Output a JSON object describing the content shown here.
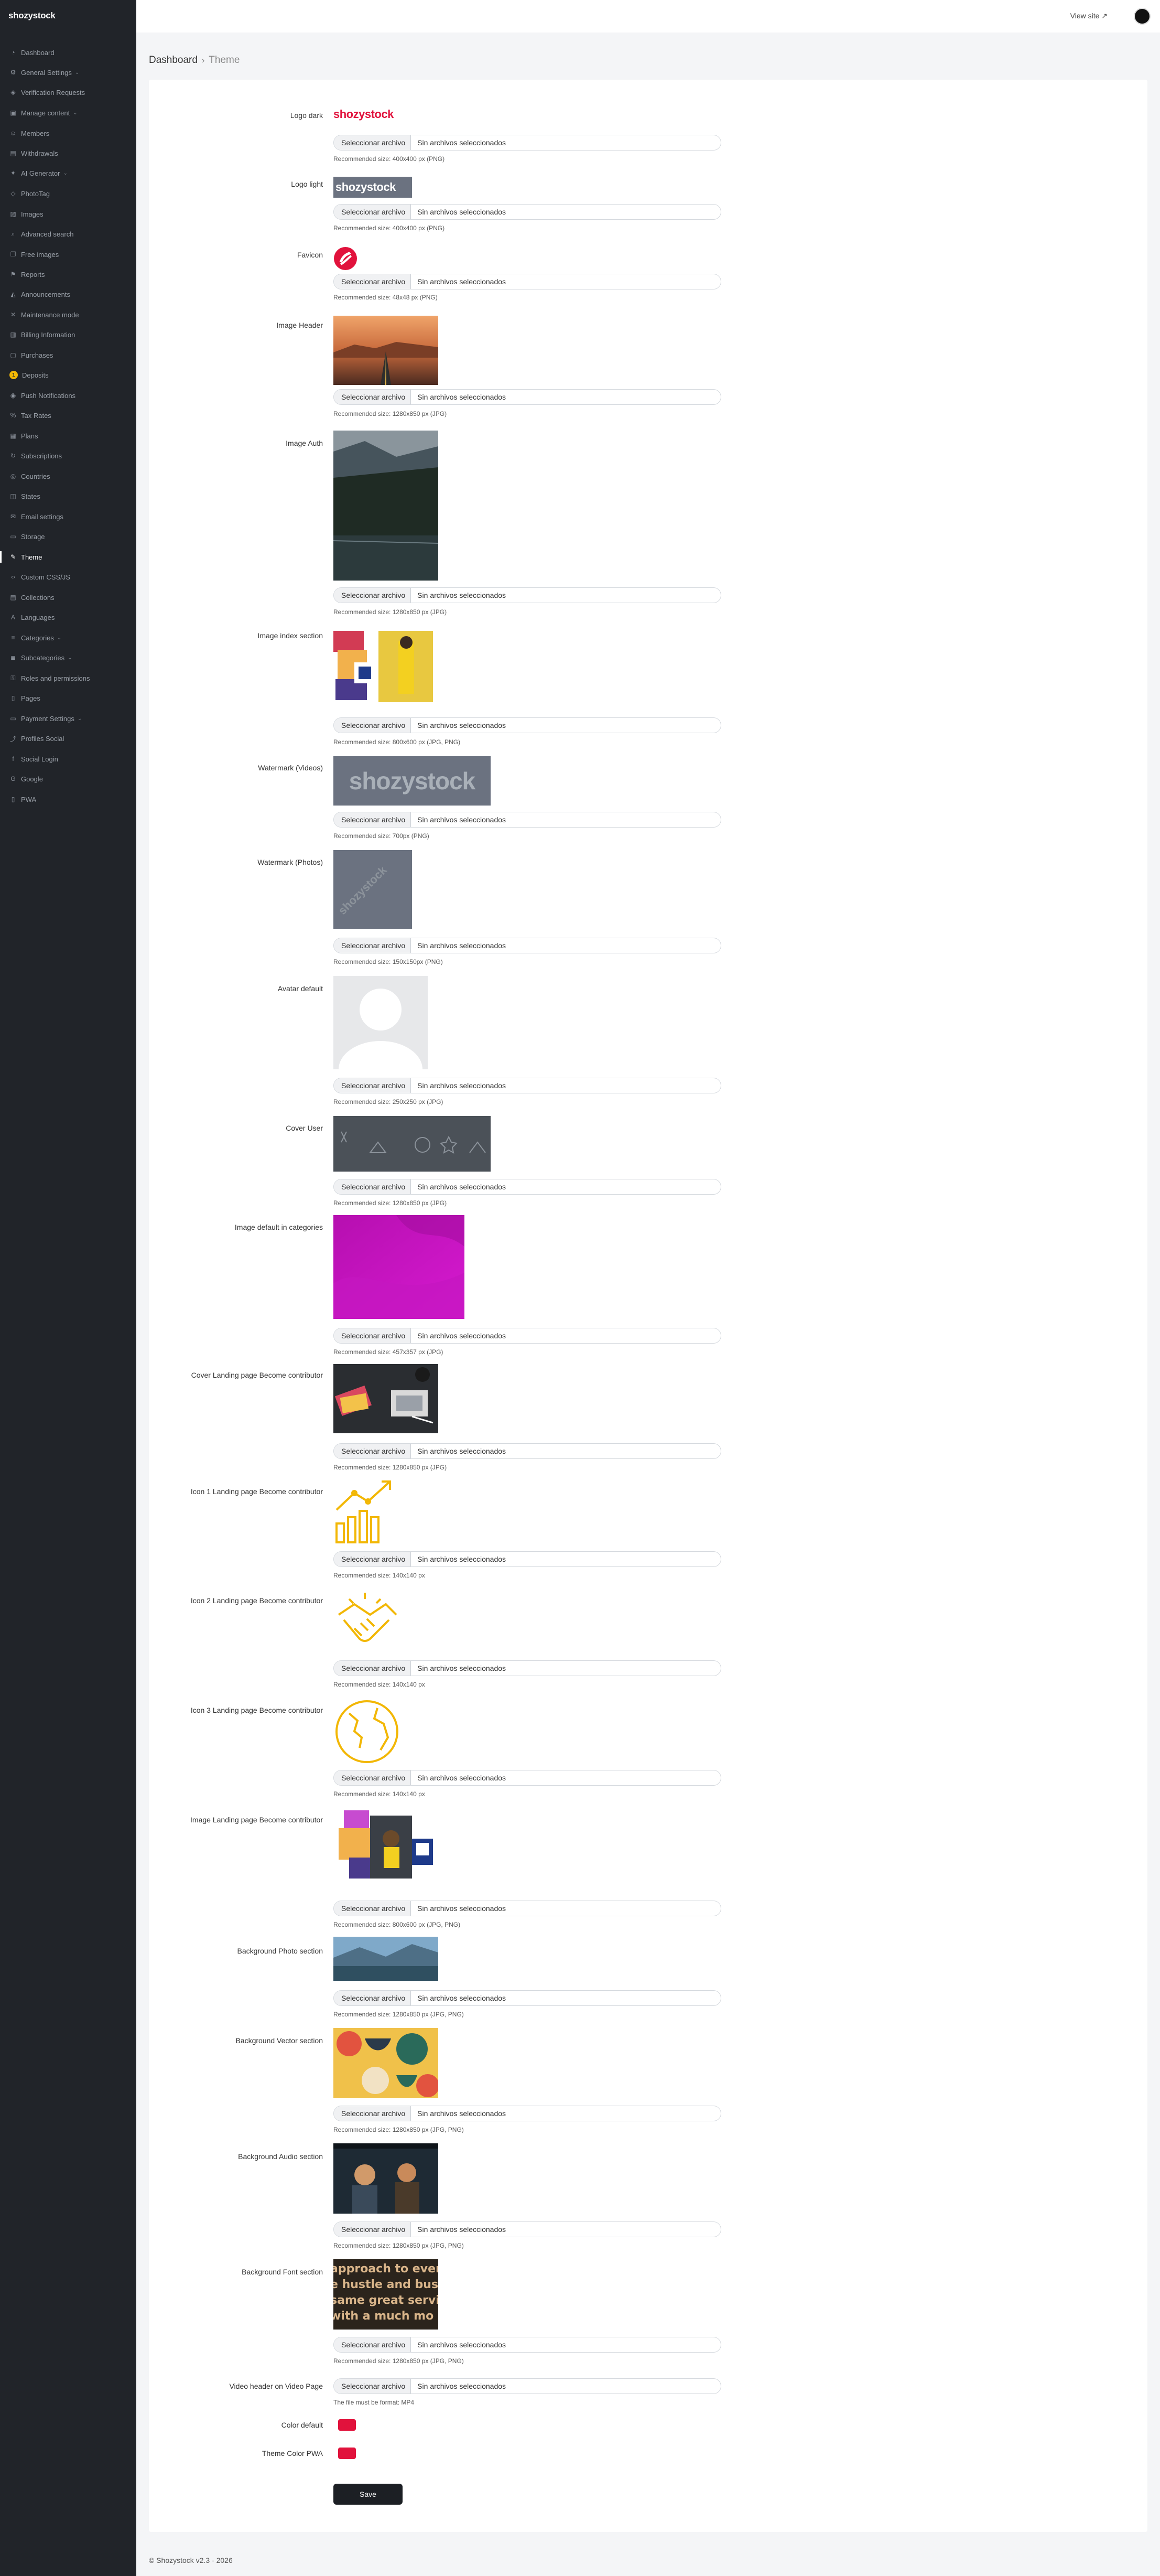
{
  "sidebar": {
    "brand": "shozystock",
    "items": [
      {
        "label": "Dashboard",
        "icon": "speedometer-icon",
        "glyph": "◔"
      },
      {
        "label": "General Settings",
        "icon": "gear-icon",
        "glyph": "⚙",
        "chevron": true
      },
      {
        "label": "Verification Requests",
        "icon": "shield-check-icon",
        "glyph": "◈"
      },
      {
        "label": "Manage content",
        "icon": "images-icon",
        "glyph": "▣",
        "chevron": true
      },
      {
        "label": "Members",
        "icon": "people-icon",
        "glyph": "☺"
      },
      {
        "label": "Withdrawals",
        "icon": "bank-icon",
        "glyph": "▤"
      },
      {
        "label": "AI Generator",
        "icon": "robot-icon",
        "glyph": "✦",
        "chevron": true
      },
      {
        "label": "PhotoTag",
        "icon": "tag-icon",
        "glyph": "◇"
      },
      {
        "label": "Images",
        "icon": "image-icon",
        "glyph": "▨"
      },
      {
        "label": "Advanced search",
        "icon": "search-icon",
        "glyph": "⌕"
      },
      {
        "label": "Free images",
        "icon": "gift-icon",
        "glyph": "❐"
      },
      {
        "label": "Reports",
        "icon": "flag-icon",
        "glyph": "⚑"
      },
      {
        "label": "Announcements",
        "icon": "megaphone-icon",
        "glyph": "◭"
      },
      {
        "label": "Maintenance mode",
        "icon": "tools-icon",
        "glyph": "✕"
      },
      {
        "label": "Billing Information",
        "icon": "receipt-icon",
        "glyph": "▥"
      },
      {
        "label": "Purchases",
        "icon": "bag-icon",
        "glyph": "▢"
      },
      {
        "label": "Deposits",
        "icon": "cash-icon",
        "glyph": "$",
        "badge": "1"
      },
      {
        "label": "Push Notifications",
        "icon": "bell-icon",
        "glyph": "◉"
      },
      {
        "label": "Tax Rates",
        "icon": "percent-icon",
        "glyph": "%"
      },
      {
        "label": "Plans",
        "icon": "box-icon",
        "glyph": "▦"
      },
      {
        "label": "Subscriptions",
        "icon": "refresh-icon",
        "glyph": "↻"
      },
      {
        "label": "Countries",
        "icon": "globe-icon",
        "glyph": "◎"
      },
      {
        "label": "States",
        "icon": "map-icon",
        "glyph": "◫"
      },
      {
        "label": "Email settings",
        "icon": "envelope-icon",
        "glyph": "✉"
      },
      {
        "label": "Storage",
        "icon": "hdd-icon",
        "glyph": "▭"
      },
      {
        "label": "Theme",
        "icon": "brush-icon",
        "glyph": "✎",
        "active": true
      },
      {
        "label": "Custom CSS/JS",
        "icon": "code-icon",
        "glyph": "‹›"
      },
      {
        "label": "Collections",
        "icon": "collection-icon",
        "glyph": "▤"
      },
      {
        "label": "Languages",
        "icon": "translate-icon",
        "glyph": "A"
      },
      {
        "label": "Categories",
        "icon": "list-icon",
        "glyph": "≡",
        "chevron": true
      },
      {
        "label": "Subcategories",
        "icon": "list-nested-icon",
        "glyph": "≣",
        "chevron": true
      },
      {
        "label": "Roles and permissions",
        "icon": "lock-icon",
        "glyph": "⚿"
      },
      {
        "label": "Pages",
        "icon": "file-icon",
        "glyph": "▯"
      },
      {
        "label": "Payment Settings",
        "icon": "credit-card-icon",
        "glyph": "▭",
        "chevron": true
      },
      {
        "label": "Profiles Social",
        "icon": "share-icon",
        "glyph": "⤴"
      },
      {
        "label": "Social Login",
        "icon": "facebook-icon",
        "glyph": "f"
      },
      {
        "label": "Google",
        "icon": "google-icon",
        "glyph": "G"
      },
      {
        "label": "PWA",
        "icon": "phone-icon",
        "glyph": "▯"
      }
    ]
  },
  "topbar": {
    "view_site": "View site ↗"
  },
  "breadcrumb": {
    "root": "Dashboard",
    "current": "Theme"
  },
  "form": {
    "choose_file": "Seleccionar archivo",
    "no_file": "Sin archivos seleccionados",
    "rows": [
      {
        "label": "Logo dark",
        "hint": "Recommended size: 400x400 px (PNG)",
        "preview": "logo-dark"
      },
      {
        "label": "Logo light",
        "hint": "Recommended size: 400x400 px (PNG)",
        "preview": "logo-light"
      },
      {
        "label": "Favicon",
        "hint": "Recommended size: 48x48 px (PNG)",
        "preview": "favicon"
      },
      {
        "label": "Image Header",
        "hint": "Recommended size: 1280x850 px (JPG)",
        "preview": "header"
      },
      {
        "label": "Image Auth",
        "hint": "Recommended size: 1280x850 px (JPG)",
        "preview": "auth"
      },
      {
        "label": "Image index section",
        "hint": "Recommended size: 800x600 px (JPG, PNG)",
        "preview": "index"
      },
      {
        "label": "Watermark (Videos)",
        "hint": "Recommended size: 700px (PNG)",
        "preview": "wm-video"
      },
      {
        "label": "Watermark (Photos)",
        "hint": "Recommended size: 150x150px (PNG)",
        "preview": "wm-photo"
      },
      {
        "label": "Avatar default",
        "hint": "Recommended size: 250x250 px (JPG)",
        "preview": "avatar"
      },
      {
        "label": "Cover User",
        "hint": "Recommended size: 1280x850 px (JPG)",
        "preview": "cover"
      },
      {
        "label": "Image default in categories",
        "hint": "Recommended size: 457x357 px (JPG)",
        "preview": "category"
      },
      {
        "label": "Cover Landing page Become contributor",
        "hint": "Recommended size: 1280x850 px (JPG)",
        "preview": "landing-cover"
      },
      {
        "label": "Icon 1 Landing page Become contributor",
        "hint": "Recommended size: 140x140 px",
        "preview": "icon1"
      },
      {
        "label": "Icon 2 Landing page Become contributor",
        "hint": "Recommended size: 140x140 px",
        "preview": "icon2"
      },
      {
        "label": "Icon 3 Landing page Become contributor",
        "hint": "Recommended size: 140x140 px",
        "preview": "icon3"
      },
      {
        "label": "Image Landing page Become contributor",
        "hint": "Recommended size: 800x600 px (JPG, PNG)",
        "preview": "landing-image"
      },
      {
        "label": "Background Photo section",
        "hint": "Recommended size: 1280x850 px (JPG, PNG)",
        "preview": "bg-photo"
      },
      {
        "label": "Background Vector section",
        "hint": "Recommended size: 1280x850 px (JPG, PNG)",
        "preview": "bg-vector"
      },
      {
        "label": "Background Audio section",
        "hint": "Recommended size: 1280x850 px (JPG, PNG)",
        "preview": "bg-audio"
      },
      {
        "label": "Background Font section",
        "hint": "Recommended size: 1280x850 px (JPG, PNG)",
        "preview": "bg-font"
      },
      {
        "label": "Video header on Video Page",
        "hint": "The file must be format: MP4",
        "preview": "none"
      }
    ],
    "color_default_label": "Color default",
    "color_default": "#e1123c",
    "theme_color_pwa_label": "Theme Color PWA",
    "theme_color_pwa": "#e1123c",
    "save": "Save"
  },
  "preview_text": {
    "logo": "shozystock",
    "watermark": "shozystock",
    "font_lines": [
      "approach to even",
      "e hustle and bust",
      "same great servi",
      "with a much mo"
    ]
  },
  "footer": "© Shozystock v2.3 - 2026"
}
